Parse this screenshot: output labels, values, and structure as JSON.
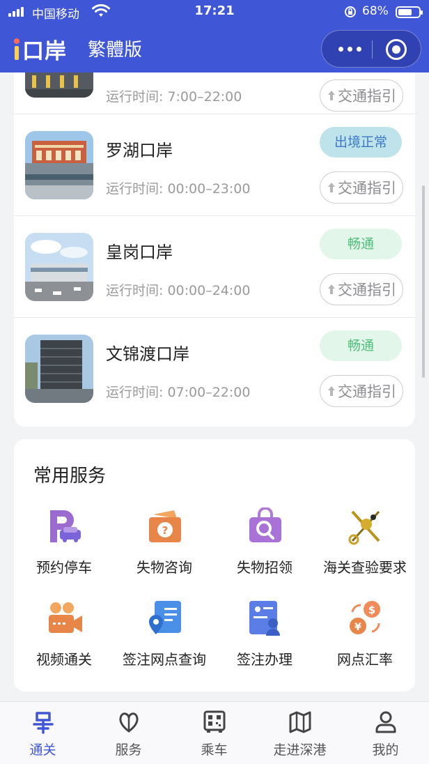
{
  "status_bar": {
    "carrier": "中国移动",
    "time": "17:21",
    "battery_percent": "68%",
    "battery_level": 0.68
  },
  "header": {
    "logo_text": "口岸",
    "trad_label": "繁體版"
  },
  "ports": [
    {
      "name": "",
      "hours": "运行时间: 7:00–22:00",
      "status": "",
      "guide": "交通指引"
    },
    {
      "name": "罗湖口岸",
      "hours": "运行时间: 00:00–23:00",
      "status": "出境正常",
      "status_color": "#3c78c8",
      "guide": "交通指引"
    },
    {
      "name": "皇岗口岸",
      "hours": "运行时间: 00:00–24:00",
      "status": "畅通",
      "status_color": "#4fbf7a",
      "guide": "交通指引"
    },
    {
      "name": "文锦渡口岸",
      "hours": "运行时间: 07:00–22:00",
      "status": "畅通",
      "status_color": "#4fbf7a",
      "guide": "交通指引"
    }
  ],
  "services": {
    "title": "常用服务",
    "items": [
      {
        "label": "预约停车",
        "icon": "parking-icon"
      },
      {
        "label": "失物咨询",
        "icon": "lost-inquiry-icon"
      },
      {
        "label": "失物招领",
        "icon": "lost-found-icon"
      },
      {
        "label": "海关查验要求",
        "icon": "customs-emblem-icon"
      },
      {
        "label": "视频通关",
        "icon": "video-camera-icon"
      },
      {
        "label": "签注网点查询",
        "icon": "visa-location-icon"
      },
      {
        "label": "签注办理",
        "icon": "visa-apply-icon"
      },
      {
        "label": "网点汇率",
        "icon": "exchange-rate-icon"
      }
    ]
  },
  "tabs": [
    {
      "label": "通关",
      "icon": "clearance-icon",
      "active": true
    },
    {
      "label": "服务",
      "icon": "service-icon",
      "active": false
    },
    {
      "label": "乘车",
      "icon": "bus-qr-icon",
      "active": false
    },
    {
      "label": "走进深港",
      "icon": "map-icon",
      "active": false
    },
    {
      "label": "我的",
      "icon": "profile-icon",
      "active": false
    }
  ],
  "colors": {
    "brand": "#3f56d6",
    "badge_blue_bg": "#bfe3ea",
    "badge_green_bg": "#e2f6ea"
  }
}
